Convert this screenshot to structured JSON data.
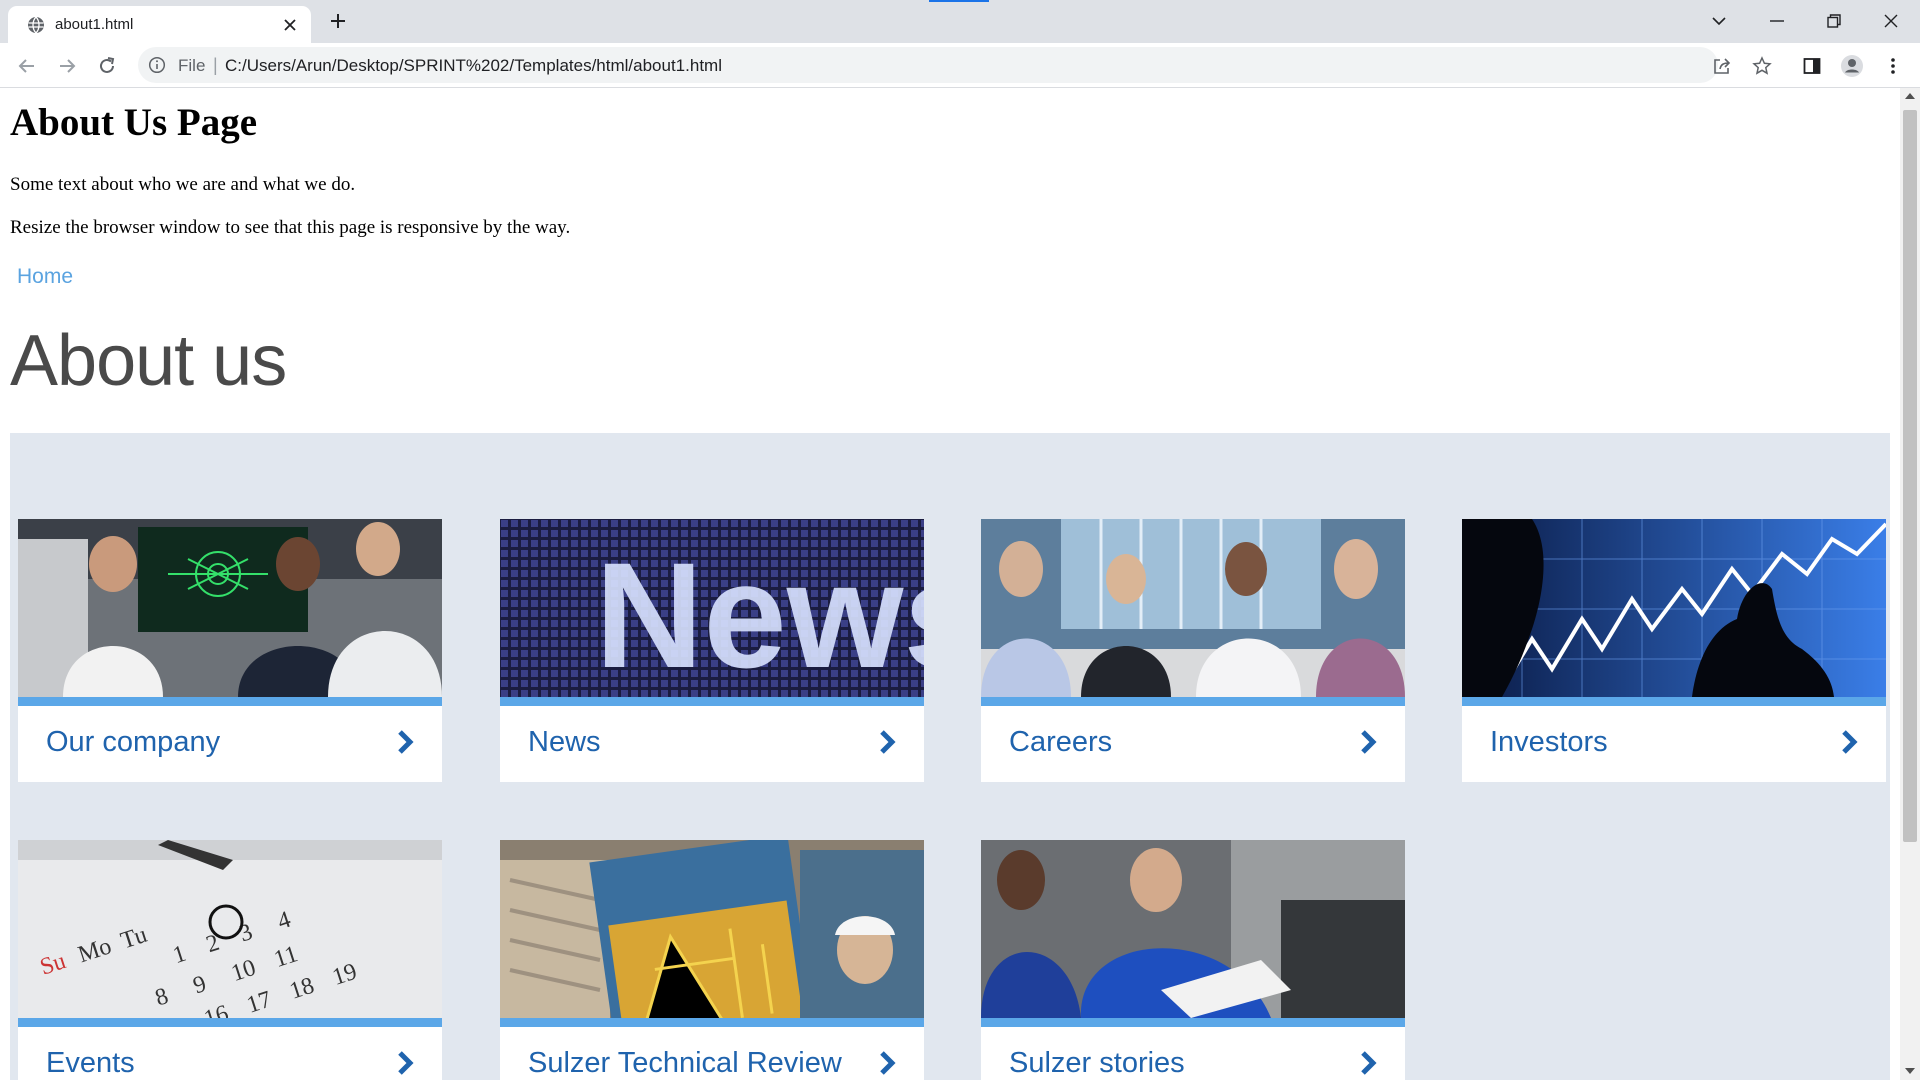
{
  "browser": {
    "tab_title": "about1.html",
    "address_scheme": "File",
    "address_separator": "|",
    "url": "C:/Users/Arun/Desktop/SPRINT%202/Templates/html/about1.html"
  },
  "page": {
    "heading": "About Us Page",
    "intro_1": "Some text about who we are and what we do.",
    "intro_2": "Resize the browser window to see that this page is responsive by the way.",
    "home_link": "Home",
    "section_title": "About us"
  },
  "cards": [
    {
      "label": "Our company",
      "image": "engineers-at-screen"
    },
    {
      "label": "News",
      "image": "news-display"
    },
    {
      "label": "Careers",
      "image": "meeting-room"
    },
    {
      "label": "Investors",
      "image": "stock-chart"
    },
    {
      "label": "Events",
      "image": "calendar"
    },
    {
      "label": "Sulzer Technical Review",
      "image": "magazine-covers"
    },
    {
      "label": "Sulzer stories",
      "image": "engineers-in-workshop"
    }
  ],
  "colors": {
    "link": "#5aa3e0",
    "card_label": "#1f63ad",
    "card_bar": "#5ba7e8",
    "panel_bg": "#e1e7ef"
  }
}
